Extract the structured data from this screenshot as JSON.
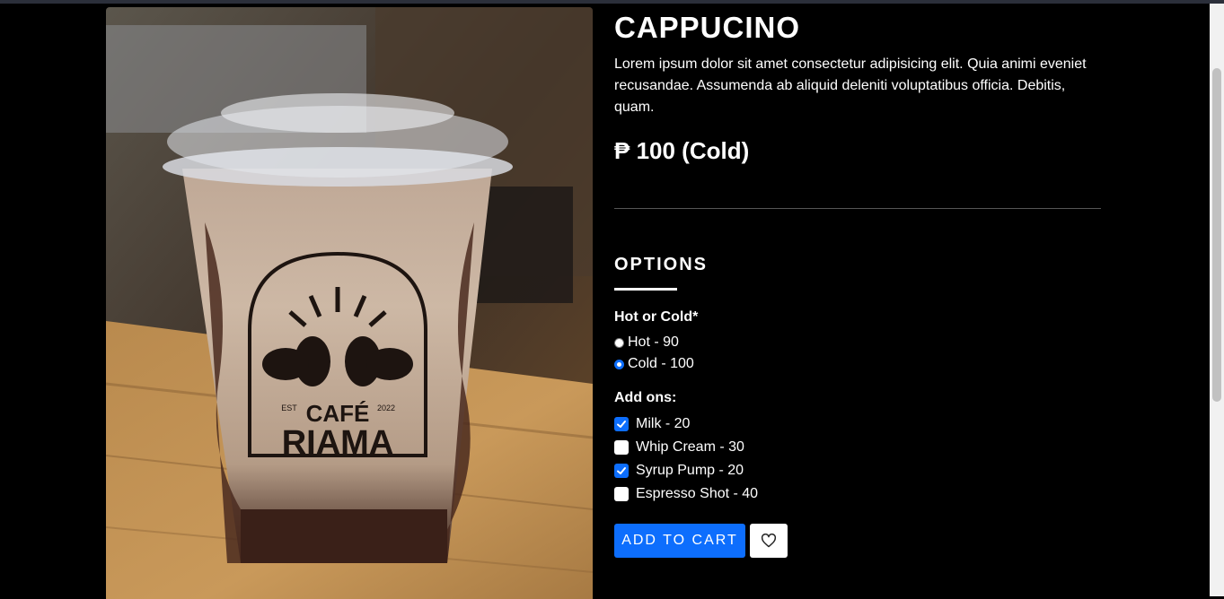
{
  "product": {
    "title": "CAPPUCINO",
    "description": "Lorem ipsum dolor sit amet consectetur adipisicing elit. Quia animi eveniet recusandae. Assumenda ab aliquid deleniti voluptatibus officia. Debitis, quam.",
    "price": "₱ 100 (Cold)",
    "image_cup_text": {
      "cafe": "CAFÉ",
      "riama": "RIAMA",
      "est": "EST",
      "year": "2022"
    }
  },
  "options": {
    "heading": "OPTIONS",
    "temperature": {
      "label": "Hot or Cold*",
      "choices": [
        {
          "label": "Hot - 90",
          "selected": false
        },
        {
          "label": "Cold - 100",
          "selected": true
        }
      ]
    },
    "addons": {
      "label": "Add ons:",
      "items": [
        {
          "label": "Milk - 20",
          "checked": true
        },
        {
          "label": "Whip Cream - 30",
          "checked": false
        },
        {
          "label": "Syrup Pump - 20",
          "checked": true
        },
        {
          "label": "Espresso Shot - 40",
          "checked": false
        }
      ]
    }
  },
  "actions": {
    "add_to_cart": "ADD TO CART",
    "wishlist_icon": "heart-icon"
  },
  "colors": {
    "accent": "#0d6efd",
    "background": "#000000"
  }
}
